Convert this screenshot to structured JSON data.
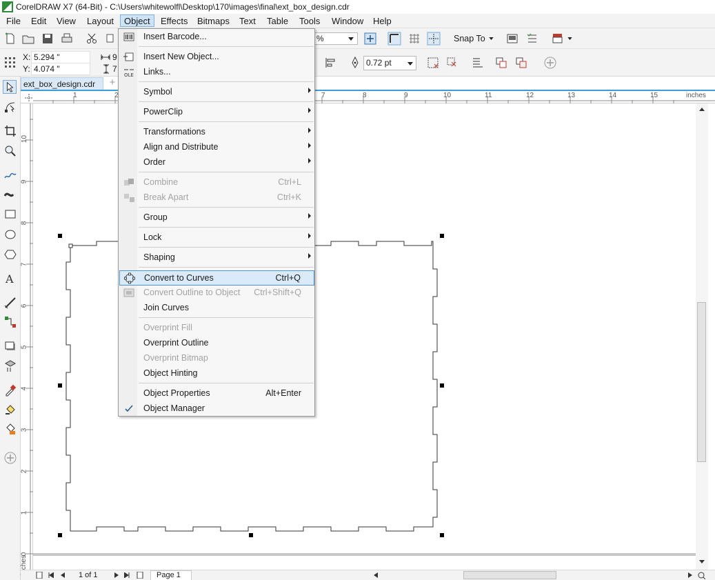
{
  "titlebar": {
    "title": "CorelDRAW X7 (64-Bit) - C:\\Users\\whitewolfl\\Desktop\\170\\images\\final\\ext_box_design.cdr"
  },
  "menubar": {
    "items": [
      "File",
      "Edit",
      "View",
      "Layout",
      "Object",
      "Effects",
      "Bitmaps",
      "Text",
      "Table",
      "Tools",
      "Window",
      "Help"
    ],
    "active": "Object"
  },
  "toolbar": {
    "zoom_value": "%",
    "snap_to_label": "Snap To",
    "x_label": "X:",
    "x_value": "5.294 \"",
    "y_label": "Y:",
    "y_value": "4.074 \"",
    "width_partial": "9",
    "height_partial": "7",
    "outline_width": "0.72 pt"
  },
  "document_tab": {
    "label": "ext_box_design.cdr",
    "add_tab": "+"
  },
  "ruler": {
    "units": "inches",
    "h_ticks": [
      "1",
      "2",
      "7",
      "8",
      "9",
      "10",
      "11",
      "12",
      "13",
      "14",
      "15"
    ],
    "v_ticks": [
      "10",
      "9",
      "8",
      "7",
      "6",
      "5",
      "4",
      "3",
      "2",
      "1",
      "0"
    ],
    "v_units": "inches"
  },
  "statusbar": {
    "page_count": "1 of 1",
    "page_name": "Page 1"
  },
  "object_menu": {
    "items": [
      {
        "label": "Insert Barcode...",
        "shortcut": "",
        "submenu": false,
        "disabled": false,
        "icon": "barcode-icon"
      },
      {
        "label": "Insert New Object...",
        "shortcut": "",
        "submenu": false,
        "disabled": false,
        "icon": "insert-object-icon"
      },
      {
        "label": "Links...",
        "shortcut": "",
        "submenu": false,
        "disabled": false,
        "icon": "ole-links-icon"
      },
      {
        "label": "Symbol",
        "shortcut": "",
        "submenu": true,
        "disabled": false,
        "icon": ""
      },
      {
        "label": "PowerClip",
        "shortcut": "",
        "submenu": true,
        "disabled": false,
        "icon": ""
      },
      {
        "label": "Transformations",
        "shortcut": "",
        "submenu": true,
        "disabled": false,
        "icon": ""
      },
      {
        "label": "Align and Distribute",
        "shortcut": "",
        "submenu": true,
        "disabled": false,
        "icon": ""
      },
      {
        "label": "Order",
        "shortcut": "",
        "submenu": true,
        "disabled": false,
        "icon": ""
      },
      {
        "label": "Combine",
        "shortcut": "Ctrl+L",
        "submenu": false,
        "disabled": true,
        "icon": "combine-icon"
      },
      {
        "label": "Break Apart",
        "shortcut": "Ctrl+K",
        "submenu": false,
        "disabled": true,
        "icon": "break-apart-icon"
      },
      {
        "label": "Group",
        "shortcut": "",
        "submenu": true,
        "disabled": false,
        "icon": ""
      },
      {
        "label": "Lock",
        "shortcut": "",
        "submenu": true,
        "disabled": false,
        "icon": ""
      },
      {
        "label": "Shaping",
        "shortcut": "",
        "submenu": true,
        "disabled": false,
        "icon": ""
      },
      {
        "label": "Convert to Curves",
        "shortcut": "Ctrl+Q",
        "submenu": false,
        "disabled": false,
        "icon": "convert-curves-icon",
        "highlighted": true
      },
      {
        "label": "Convert Outline to Object",
        "shortcut": "Ctrl+Shift+Q",
        "submenu": false,
        "disabled": true,
        "icon": "outline-object-icon"
      },
      {
        "label": "Join Curves",
        "shortcut": "",
        "submenu": false,
        "disabled": false,
        "icon": ""
      },
      {
        "label": "Overprint Fill",
        "shortcut": "",
        "submenu": false,
        "disabled": true,
        "icon": ""
      },
      {
        "label": "Overprint Outline",
        "shortcut": "",
        "submenu": false,
        "disabled": false,
        "icon": ""
      },
      {
        "label": "Overprint Bitmap",
        "shortcut": "",
        "submenu": false,
        "disabled": true,
        "icon": ""
      },
      {
        "label": "Object Hinting",
        "shortcut": "",
        "submenu": false,
        "disabled": false,
        "icon": ""
      },
      {
        "label": "Object Properties",
        "shortcut": "Alt+Enter",
        "submenu": false,
        "disabled": false,
        "icon": ""
      },
      {
        "label": "Object Manager",
        "shortcut": "",
        "submenu": false,
        "disabled": false,
        "icon": "checkmark-icon",
        "checked": true
      }
    ]
  },
  "colors": {
    "accent": "#3c9ed8",
    "menu_highlight": "#dbeaf8",
    "selection_handle": "#000000"
  }
}
